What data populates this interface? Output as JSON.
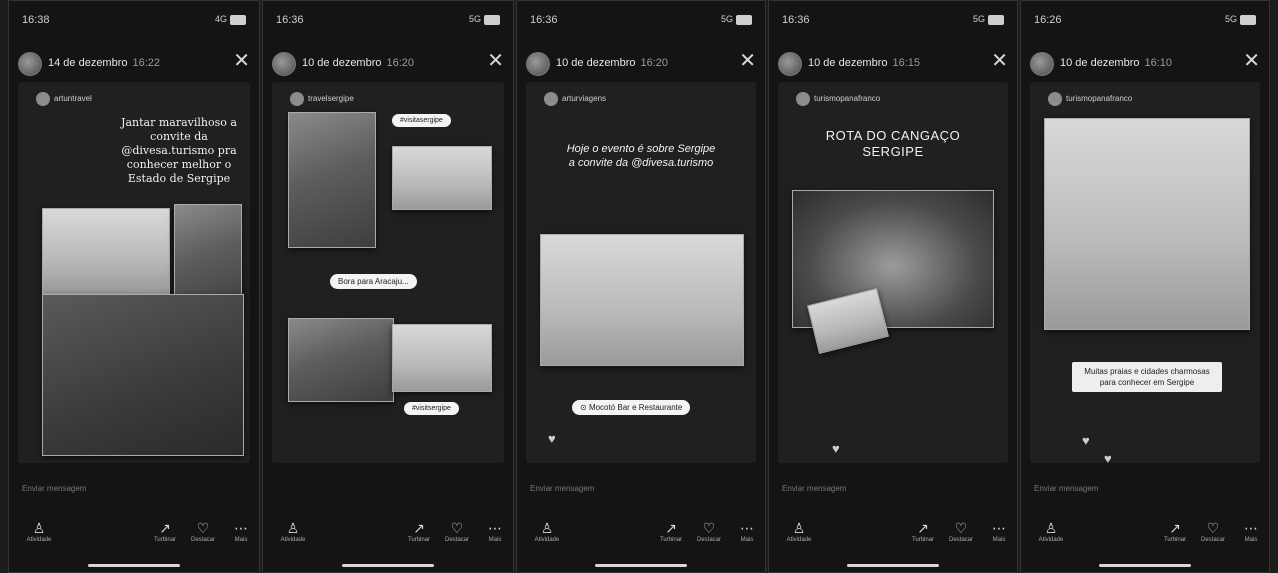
{
  "panels": [
    {
      "time": "16:38",
      "signal": "4G",
      "date": "14 de dezembro",
      "hour": "16:22",
      "handle": "artuntravel",
      "caption": "Jantar maravilhoso a convite da @divesa.turismo pra conhecer melhor o Estado de Sergipe",
      "reply_placeholder": "Enviar mensagem",
      "actions": [
        "Atividade",
        "Turbinar",
        "Destacar",
        "Mais"
      ]
    },
    {
      "time": "16:36",
      "signal": "5G",
      "date": "10 de dezembro",
      "hour": "16:20",
      "handle": "travelsergipe",
      "sticker_tag": "#visitasergipe",
      "sticker": "Bora para Aracaju...",
      "sticker_small": "#visitsergipe",
      "actions": [
        "Atividade",
        "Turbinar",
        "Destacar",
        "Mais"
      ]
    },
    {
      "time": "16:36",
      "signal": "5G",
      "date": "10 de dezembro",
      "hour": "16:20",
      "handle": "arturviagens",
      "caption": "Hoje o evento é sobre Sergipe a convite da @divesa.turismo",
      "location": "Mocotó Bar e Restaurante",
      "reply_placeholder": "Enviar mensagem",
      "actions": [
        "Atividade",
        "Turbinar",
        "Destacar",
        "Mais"
      ]
    },
    {
      "time": "16:36",
      "signal": "5G",
      "date": "10 de dezembro",
      "hour": "16:15",
      "handle": "turismopanafranco",
      "caption": "ROTA DO CANGAÇO SERGIPE",
      "reply_placeholder": "Enviar mensagem",
      "actions": [
        "Atividade",
        "Turbinar",
        "Destacar",
        "Mais"
      ]
    },
    {
      "time": "16:26",
      "signal": "5G",
      "date": "10 de dezembro",
      "hour": "16:10",
      "handle": "turismopanafranco",
      "textbox": "Muitas praias e cidades charmosas para conhecer em Sergipe",
      "reply_placeholder": "Enviar mensagem",
      "actions": [
        "Atividade",
        "Turbinar",
        "Destacar",
        "Mais"
      ]
    }
  ],
  "icons": {
    "activity": "person-icon",
    "boost": "trend-arrow-icon",
    "highlight": "heart-circle-icon",
    "more": "more-dots-icon",
    "close": "close-icon"
  }
}
